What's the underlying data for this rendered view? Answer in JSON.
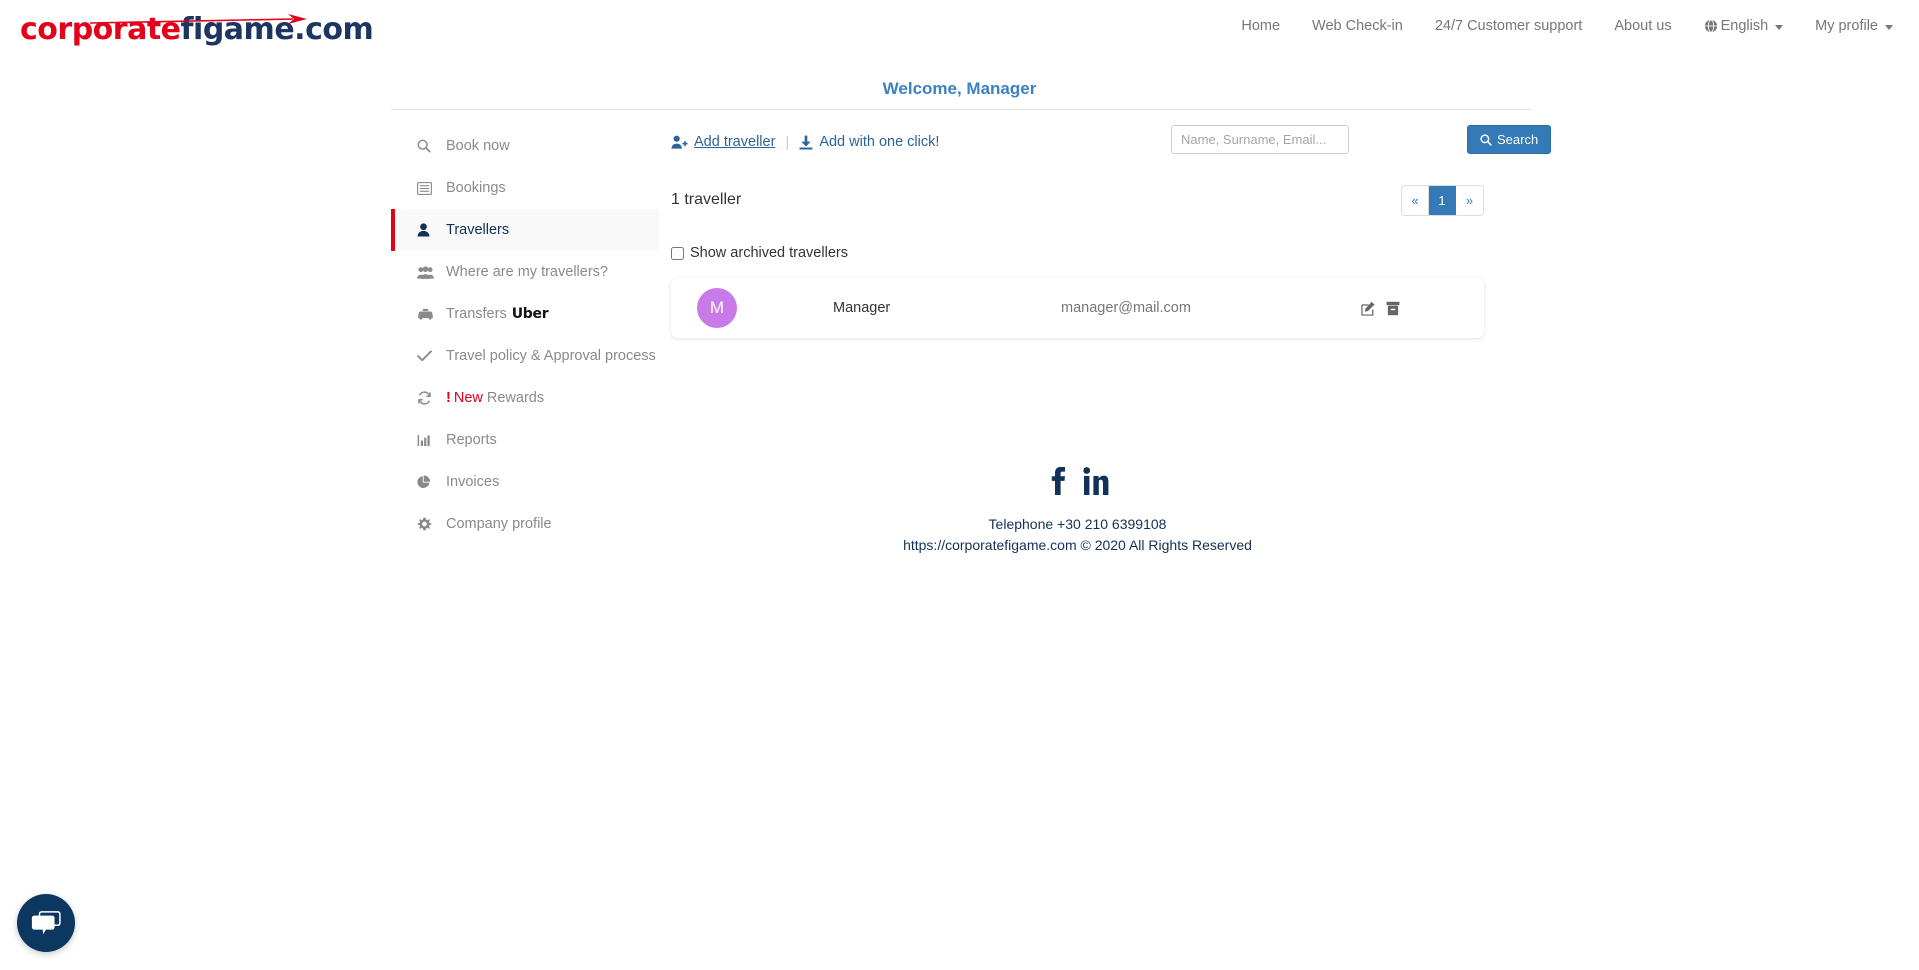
{
  "brand": {
    "logo_part1": "corporate",
    "logo_part2": "figame",
    "logo_part3": ".com",
    "accent_red": "#e2001a",
    "accent_navy": "#1d3661"
  },
  "topnav": {
    "items": [
      {
        "label": "Home",
        "icon": "",
        "caret": false
      },
      {
        "label": "Web Check-in",
        "icon": "",
        "caret": false
      },
      {
        "label": "24/7 Customer support",
        "icon": "",
        "caret": false
      },
      {
        "label": "About us",
        "icon": "",
        "caret": false
      },
      {
        "label": "English",
        "icon": "globe-icon",
        "caret": true
      },
      {
        "label": "My profile",
        "icon": "",
        "caret": true
      }
    ]
  },
  "header": {
    "welcome": "Welcome, Manager"
  },
  "sidebar": {
    "items": [
      {
        "label": "Book now",
        "icon": "search-icon",
        "active": false
      },
      {
        "label": "Bookings",
        "icon": "list-icon",
        "active": false
      },
      {
        "label": "Travellers",
        "icon": "user-icon",
        "active": true
      },
      {
        "label": "Where are my travellers?",
        "icon": "users-icon",
        "active": false
      },
      {
        "label": "Transfers",
        "icon": "taxi-icon",
        "active": false,
        "suffix": "Uber"
      },
      {
        "label": "Travel policy & Approval process",
        "icon": "check-icon",
        "active": false
      },
      {
        "label": "Rewards",
        "icon": "refresh-icon",
        "active": false,
        "badge": "!",
        "badge_word": "New"
      },
      {
        "label": "Reports",
        "icon": "chart-bar-icon",
        "active": false
      },
      {
        "label": "Invoices",
        "icon": "pie-chart-icon",
        "active": false
      },
      {
        "label": "Company profile",
        "icon": "gear-icon",
        "active": false
      }
    ]
  },
  "toolbar": {
    "add_traveller": "Add traveller",
    "separator": "|",
    "add_one_click": "Add with one click!",
    "search_placeholder": "Name, Surname, Email...",
    "search_value": "",
    "search_button": "Search"
  },
  "list": {
    "count_label": "1 traveller",
    "archived_label": "Show archived travellers",
    "archived_checked": false,
    "rows": [
      {
        "initial": "M",
        "avatar_color": "#c77ae8",
        "name": "Manager",
        "email": "manager@mail.com",
        "edit_icon": "edit-icon",
        "archive_icon": "archive-icon"
      }
    ]
  },
  "pagination": {
    "prev": "«",
    "pages": [
      "1"
    ],
    "next": "»",
    "current": "1"
  },
  "footer": {
    "social": [
      {
        "name": "facebook-icon",
        "glyph": "f"
      },
      {
        "name": "linkedin-icon",
        "glyph": "in"
      }
    ],
    "telephone": "Telephone +30 210 6399108",
    "copyright": "https://corporatefigame.com © 2020 All Rights Reserved"
  },
  "chat": {
    "icon": "chat-bubble-icon"
  }
}
